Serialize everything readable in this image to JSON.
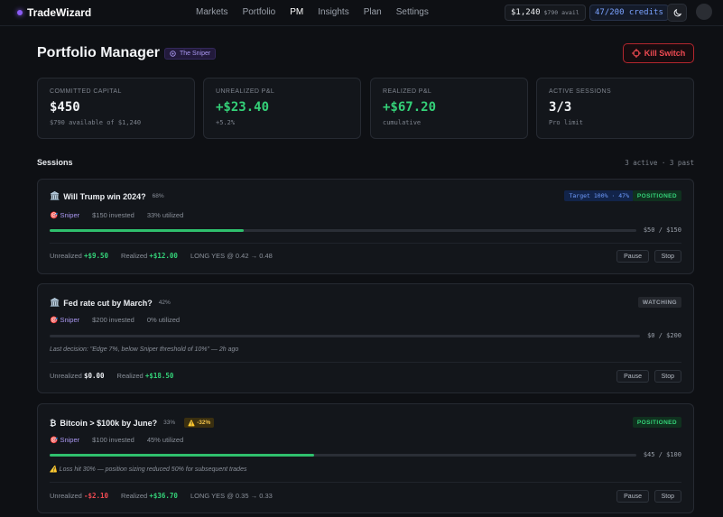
{
  "brand": {
    "name": "TradeWizard"
  },
  "nav": {
    "items": [
      "Markets",
      "Portfolio",
      "PM",
      "Insights",
      "Plan",
      "Settings"
    ],
    "active": "PM"
  },
  "wallet": {
    "balance": "$1,240",
    "available": "$790 avail",
    "credits": "47/200 credits"
  },
  "header": {
    "title": "Portfolio Manager",
    "strategy": "The Sniper",
    "kill_switch": "Kill Switch"
  },
  "stats": [
    {
      "label": "COMMITTED CAPITAL",
      "value": "$450",
      "sub": "$790 available of $1,240"
    },
    {
      "label": "UNREALIZED P&L",
      "value": "+$23.40",
      "sub": "+5.2%"
    },
    {
      "label": "REALIZED P&L",
      "value": "+$67.20",
      "sub": "cumulative"
    },
    {
      "label": "ACTIVE SESSIONS",
      "value": "3/3",
      "sub": "Pro limit"
    }
  ],
  "sessions": {
    "title": "Sessions",
    "count": "3 active · 3 past",
    "cards": [
      {
        "title": "Will Trump win 2024?",
        "icon": "bank-icon",
        "prob": "68%",
        "target": "Target 100% · 47%",
        "status": "POSITIONED",
        "strategy": "Sniper",
        "invested": "$150 invested",
        "utilized": "33% utilized",
        "progress": 0.33,
        "bar_text": "$50 / $150",
        "unrealized_label": "Unrealized",
        "unrealized": "+$9.50",
        "realized_label": "Realized",
        "realized": "+$12.00",
        "position": "LONG YES @ 0.42 → 0.48",
        "pause": "Pause",
        "stop": "Stop"
      },
      {
        "title": "Fed rate cut by March?",
        "icon": "bank-icon",
        "prob": "42%",
        "status": "WATCHING",
        "strategy": "Sniper",
        "invested": "$200 invested",
        "utilized": "0% utilized",
        "progress": 0,
        "bar_text": "$0 / $200",
        "note": "Last decision: \"Edge 7%, below Sniper threshold of 10%\" — 2h ago",
        "unrealized_label": "Unrealized",
        "unrealized": "$0.00",
        "realized_label": "Realized",
        "realized": "+$18.50",
        "pause": "Pause",
        "stop": "Stop"
      },
      {
        "title": "Bitcoin > $100k by June?",
        "icon": "bitcoin-icon",
        "prob": "33%",
        "warning": "-32%",
        "status": "POSITIONED",
        "strategy": "Sniper",
        "invested": "$100 invested",
        "utilized": "45% utilized",
        "progress": 0.45,
        "bar_text": "$45 / $100",
        "note": "Loss hit 30% — position sizing reduced 50% for subsequent trades",
        "unrealized_label": "Unrealized",
        "unrealized": "-$2.10",
        "realized_label": "Realized",
        "realized": "+$36.70",
        "position": "LONG YES @ 0.35 → 0.33",
        "pause": "Pause",
        "stop": "Stop"
      }
    ]
  },
  "colors": {
    "accent": "#8b5cf6",
    "positive": "#34d178",
    "negative": "#f04a52",
    "kill": "#b3262e"
  }
}
